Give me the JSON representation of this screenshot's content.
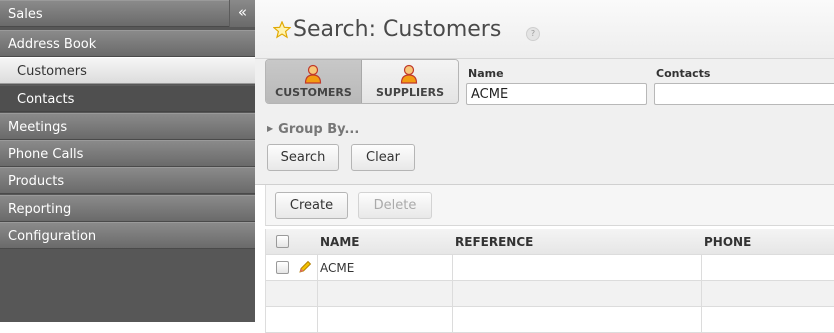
{
  "sidebar": {
    "items": [
      {
        "label": "Sales",
        "level": 0
      },
      {
        "label": "Address Book",
        "level": 0
      },
      {
        "label": "Customers",
        "level": 1,
        "active": true
      },
      {
        "label": "Contacts",
        "level": 1
      },
      {
        "label": "Meetings",
        "level": 0
      },
      {
        "label": "Phone Calls",
        "level": 0
      },
      {
        "label": "Products",
        "level": 0
      },
      {
        "label": "Reporting",
        "level": 0
      },
      {
        "label": "Configuration",
        "level": 0
      }
    ],
    "collapse_label": "«"
  },
  "header": {
    "title": "Search: Customers",
    "help_label": "?"
  },
  "search": {
    "toggles": [
      {
        "label": "CUSTOMERS",
        "active": true
      },
      {
        "label": "SUPPLIERS",
        "active": false
      }
    ],
    "fields": [
      {
        "label": "Name",
        "value": "ACME"
      },
      {
        "label": "Contacts",
        "value": ""
      }
    ],
    "group_by_label": "Group By...",
    "search_button": "Search",
    "clear_button": "Clear"
  },
  "list": {
    "create_button": "Create",
    "delete_button": "Delete",
    "columns": [
      "NAME",
      "REFERENCE",
      "PHONE"
    ],
    "rows": [
      {
        "name": "ACME",
        "reference": "",
        "phone": ""
      }
    ]
  },
  "colors": {
    "sidebar_bg": "#575757",
    "star": "#f2b400",
    "pencil": "#e8b800"
  }
}
